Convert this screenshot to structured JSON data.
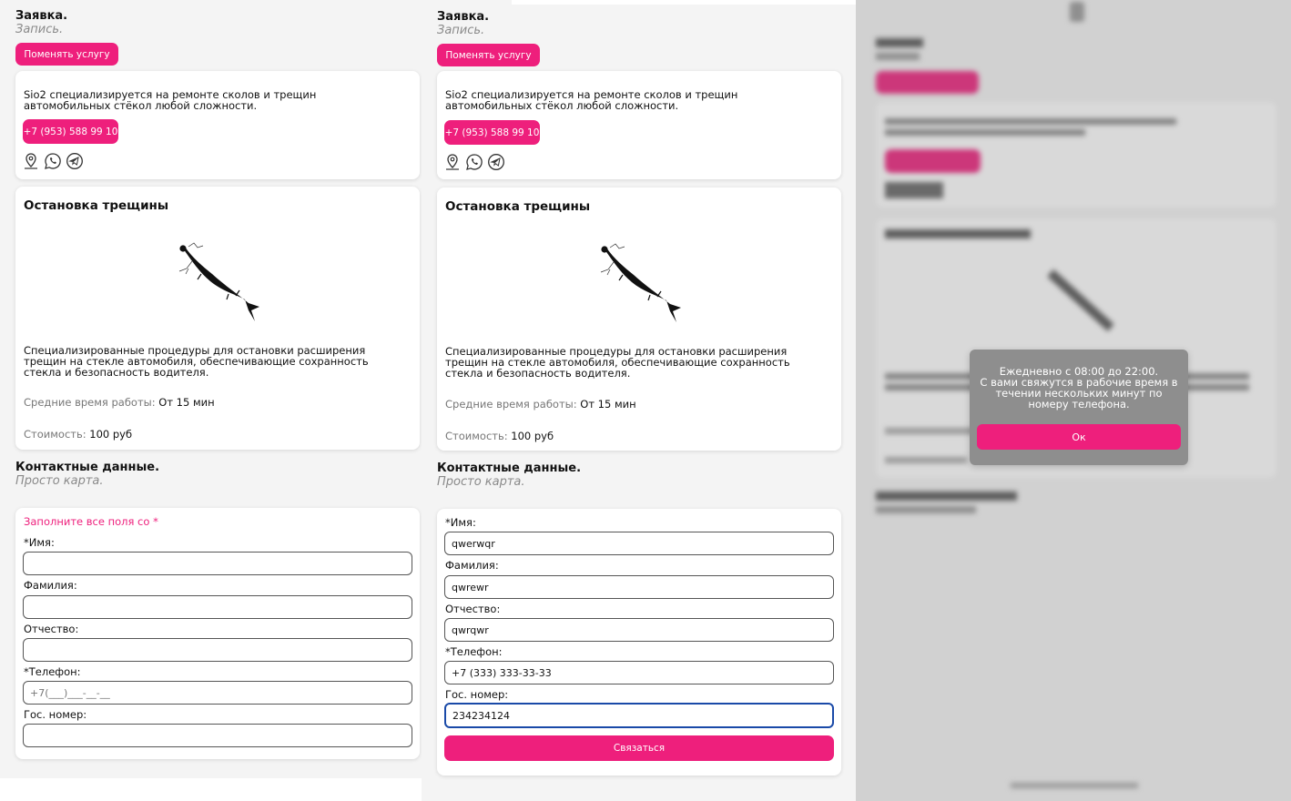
{
  "header": {
    "title": "Заявка.",
    "subtitle": "Запись.",
    "change_service_button": "Поменять услугу"
  },
  "company": {
    "description_line1": "Sio2 специализируется на ремонте сколов и трещин",
    "description_line2": "автомобильных стёкол любой сложности.",
    "phone": "+7 (953) 588 99 10",
    "icons": [
      "map-pin-icon",
      "whatsapp-icon",
      "telegram-icon"
    ]
  },
  "service": {
    "title": "Остановка трещины",
    "description_line1": "Специализированные процедуры для остановки расширения",
    "description_line2": "трещин на стекле автомобиля, обеспечивающие сохранность",
    "description_line3": "стекла и безопасность водителя.",
    "time_label": "Средние время работы:",
    "time_value": "От 15 мин",
    "price_label": "Стоимость:",
    "price_value": "100 руб"
  },
  "contacts": {
    "title": "Контактные данные.",
    "subtitle": "Просто карта."
  },
  "form_empty": {
    "warning": "Заполните все поля со *",
    "name_label": "*Имя:",
    "surname_label": "Фамилия:",
    "patronymic_label": "Отчество:",
    "phone_label": "*Телефон:",
    "phone_placeholder": "+7(___)___-__-__",
    "plate_label": "Гос. номер:"
  },
  "form_filled": {
    "name_label": "*Имя:",
    "name_value": "qwerwqr",
    "surname_label": "Фамилия:",
    "surname_value": "qwrewr",
    "patronymic_label": "Отчество:",
    "patronymic_value": "qwrqwr",
    "phone_label": "*Телефон:",
    "phone_value": "+7 (333) 333-33-33",
    "plate_label": "Гос. номер:",
    "plate_value": "234234124",
    "submit_button": "Связаться"
  },
  "modal": {
    "line1": "Ежедневно с 08:00 до 22:00.",
    "line2": "С вами свяжутся в рабочие время в",
    "line3": "течении нескольких минут по",
    "line4": "номеру телефона.",
    "ok_button": "Ок"
  },
  "colors": {
    "accent": "#ee1f7c",
    "focus_border": "#1a4aa8",
    "background": "#f4f4f4"
  }
}
